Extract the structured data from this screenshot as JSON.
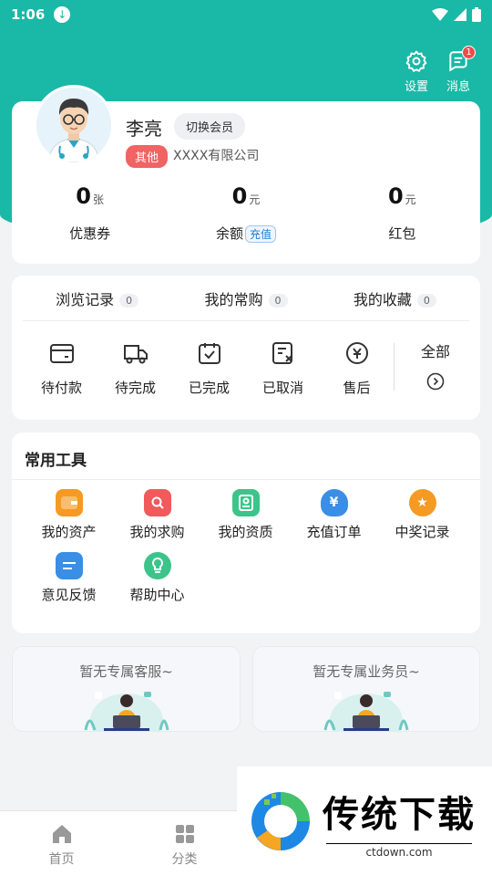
{
  "status_bar": {
    "time": "1:06"
  },
  "top_actions": {
    "settings_label": "设置",
    "messages_label": "消息",
    "messages_badge": "1"
  },
  "profile": {
    "name": "李亮",
    "switch_label": "切换会员",
    "tag": "其他",
    "company": "XXXX有限公司"
  },
  "stats": [
    {
      "value": "0",
      "unit": "张",
      "label": "优惠券"
    },
    {
      "value": "0",
      "unit": "元",
      "label": "余额",
      "action": "充值"
    },
    {
      "value": "0",
      "unit": "元",
      "label": "红包"
    }
  ],
  "record_tabs": [
    {
      "label": "浏览记录",
      "count": "0"
    },
    {
      "label": "我的常购",
      "count": "0"
    },
    {
      "label": "我的收藏",
      "count": "0"
    }
  ],
  "orders": [
    {
      "label": "待付款",
      "icon": "wallet-icon"
    },
    {
      "label": "待完成",
      "icon": "truck-icon"
    },
    {
      "label": "已完成",
      "icon": "check-bag-icon"
    },
    {
      "label": "已取消",
      "icon": "cancel-doc-icon"
    },
    {
      "label": "售后",
      "icon": "refund-icon"
    }
  ],
  "orders_all": "全部",
  "tools": {
    "title": "常用工具",
    "items": [
      {
        "label": "我的资产",
        "icon": "wallet-orange-icon",
        "color": "#f59a23"
      },
      {
        "label": "我的求购",
        "icon": "search-bag-icon",
        "color": "#f05a5a"
      },
      {
        "label": "我的资质",
        "icon": "certificate-icon",
        "color": "#3cc48a"
      },
      {
        "label": "充值订单",
        "icon": "money-bag-icon",
        "color": "#3a8ee6"
      },
      {
        "label": "中奖记录",
        "icon": "medal-icon",
        "color": "#f59a23"
      },
      {
        "label": "意见反馈",
        "icon": "feedback-icon",
        "color": "#3a8ee6"
      },
      {
        "label": "帮助中心",
        "icon": "bulb-icon",
        "color": "#3cc48a"
      }
    ]
  },
  "service": {
    "customer_service": "暂无专属客服~",
    "salesperson": "暂无专属业务员~"
  },
  "bottom_nav": [
    {
      "label": "首页",
      "icon": "home-icon"
    },
    {
      "label": "分类",
      "icon": "grid-icon"
    }
  ],
  "watermark": {
    "title": "传统下载",
    "url": "ctdown.com"
  },
  "colors": {
    "primary": "#1ab8a6",
    "danger": "#f06464",
    "link": "#1a7fd6"
  }
}
